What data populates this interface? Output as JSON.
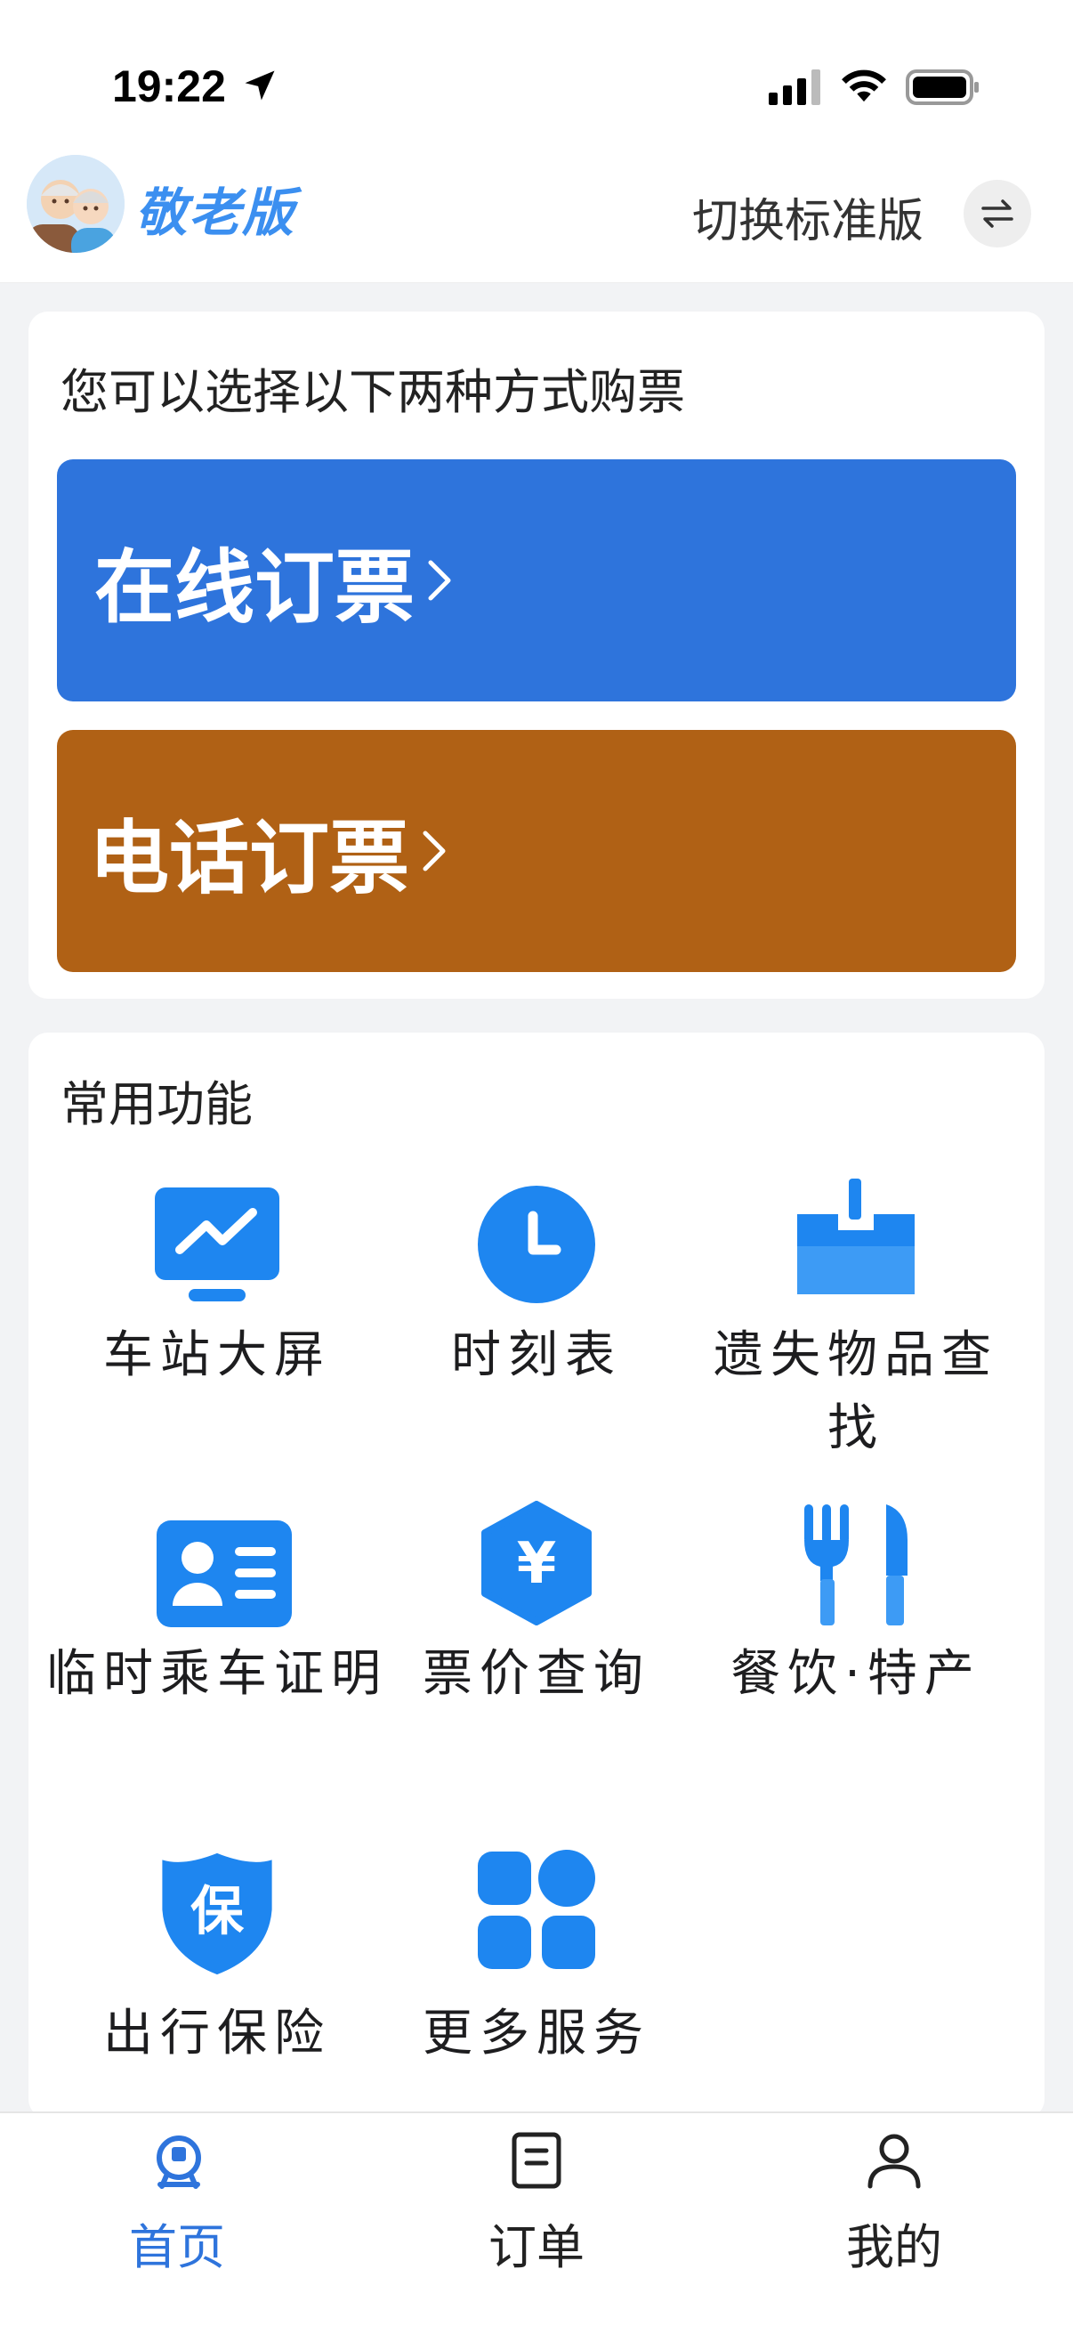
{
  "status_bar": {
    "time": "19:22",
    "icons": [
      "location-arrow-icon",
      "signal-icon",
      "wifi-icon",
      "battery-icon"
    ]
  },
  "header": {
    "logo_text": "敬老版",
    "switch_label": "切换标准版",
    "switch_icon": "swap-icon"
  },
  "booking": {
    "title": "您可以选择以下两种方式购票",
    "online_label": "在线订票",
    "phone_label": "电话订票",
    "online_color": "#2e74dc",
    "phone_color": "#b06115"
  },
  "functions": {
    "title": "常用功能",
    "items": [
      {
        "label": "车站大屏",
        "icon": "monitor-chart-icon"
      },
      {
        "label": "时刻表",
        "icon": "clock-icon"
      },
      {
        "label": "遗失物品查找",
        "icon": "lost-box-icon"
      },
      {
        "label": "临时乘车证明",
        "icon": "id-card-icon"
      },
      {
        "label": "票价查询",
        "icon": "yuan-hexagon-icon"
      },
      {
        "label": "餐饮·特产",
        "icon": "fork-knife-icon"
      },
      {
        "label": "出行保险",
        "icon": "shield-insurance-icon"
      },
      {
        "label": "更多服务",
        "icon": "grid-apps-icon"
      }
    ],
    "insurance_glyph": "保",
    "yuan_glyph": "¥"
  },
  "tabbar": {
    "tabs": [
      {
        "label": "首页",
        "icon": "home-train-icon",
        "active": true
      },
      {
        "label": "订单",
        "icon": "order-document-icon",
        "active": false
      },
      {
        "label": "我的",
        "icon": "user-icon",
        "active": false
      }
    ]
  },
  "colors": {
    "accent": "#2e74dc",
    "icon_blue": "#1e86f0"
  }
}
